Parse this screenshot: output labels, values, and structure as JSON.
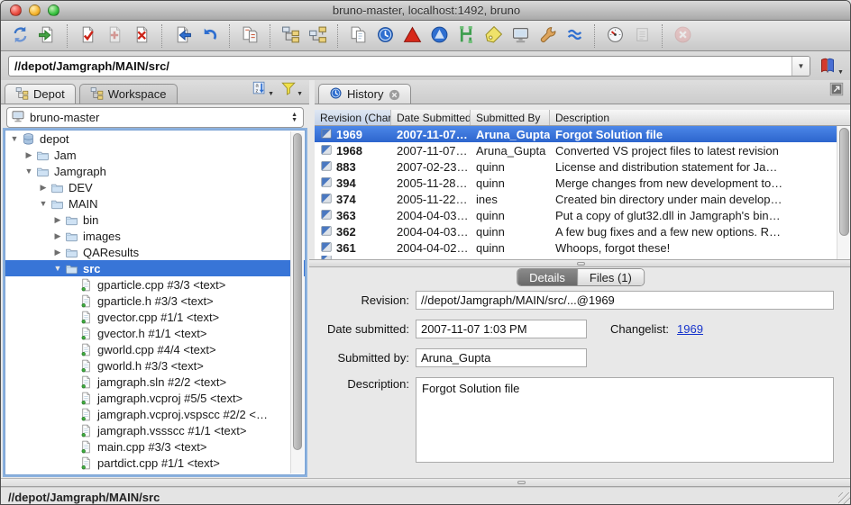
{
  "window": {
    "title": "bruno-master,  localhost:1492,  bruno"
  },
  "toolbar": {
    "groups": [
      [
        "refresh",
        "get-latest"
      ],
      [
        "checkout",
        "mark-for-add",
        "mark-for-delete"
      ],
      [
        "submit",
        "revert"
      ],
      [
        "diff"
      ],
      [
        "integrate",
        "branch"
      ],
      [
        "copy",
        "timelapse-view",
        "revision-graph",
        "merge-tool",
        "branch-view",
        "label",
        "workspaces",
        "administration",
        "streams"
      ],
      [
        "dashboard",
        "log"
      ],
      [
        "stop"
      ]
    ],
    "disabled": [
      "mark-for-add",
      "log",
      "stop"
    ]
  },
  "address": {
    "value": "//depot/Jamgraph/MAIN/src/"
  },
  "left": {
    "tabs": [
      {
        "label": "Depot",
        "active": true
      },
      {
        "label": "Workspace",
        "active": false
      }
    ],
    "workspace_selector": "bruno-master",
    "tree": [
      {
        "label": "depot",
        "icon": "depot",
        "depth": 0,
        "disclosure": "expanded"
      },
      {
        "label": "Jam",
        "icon": "folder",
        "depth": 1,
        "disclosure": "collapsed"
      },
      {
        "label": "Jamgraph",
        "icon": "folder",
        "depth": 1,
        "disclosure": "expanded"
      },
      {
        "label": "DEV",
        "icon": "folder",
        "depth": 2,
        "disclosure": "collapsed"
      },
      {
        "label": "MAIN",
        "icon": "folder",
        "depth": 2,
        "disclosure": "expanded"
      },
      {
        "label": "bin",
        "icon": "folder",
        "depth": 3,
        "disclosure": "collapsed"
      },
      {
        "label": "images",
        "icon": "folder",
        "depth": 3,
        "disclosure": "collapsed"
      },
      {
        "label": "QAResults",
        "icon": "folder",
        "depth": 3,
        "disclosure": "collapsed"
      },
      {
        "label": "src",
        "icon": "folder",
        "depth": 3,
        "disclosure": "expanded",
        "selected": true
      },
      {
        "label": "gparticle.cpp #3/3 <text>",
        "icon": "file",
        "depth": 4,
        "disclosure": "none"
      },
      {
        "label": "gparticle.h #3/3 <text>",
        "icon": "file",
        "depth": 4,
        "disclosure": "none"
      },
      {
        "label": "gvector.cpp #1/1 <text>",
        "icon": "file",
        "depth": 4,
        "disclosure": "none"
      },
      {
        "label": "gvector.h #1/1 <text>",
        "icon": "file",
        "depth": 4,
        "disclosure": "none"
      },
      {
        "label": "gworld.cpp #4/4 <text>",
        "icon": "file",
        "depth": 4,
        "disclosure": "none"
      },
      {
        "label": "gworld.h #3/3 <text>",
        "icon": "file",
        "depth": 4,
        "disclosure": "none"
      },
      {
        "label": "jamgraph.sln #2/2 <text>",
        "icon": "file",
        "depth": 4,
        "disclosure": "none"
      },
      {
        "label": "jamgraph.vcproj #5/5 <text>",
        "icon": "file",
        "depth": 4,
        "disclosure": "none"
      },
      {
        "label": "jamgraph.vcproj.vspscc #2/2 <…",
        "icon": "file",
        "depth": 4,
        "disclosure": "none"
      },
      {
        "label": "jamgraph.vssscc #1/1 <text>",
        "icon": "file",
        "depth": 4,
        "disclosure": "none"
      },
      {
        "label": "main.cpp #3/3 <text>",
        "icon": "file",
        "depth": 4,
        "disclosure": "none"
      },
      {
        "label": "partdict.cpp #1/1 <text>",
        "icon": "file",
        "depth": 4,
        "disclosure": "none"
      }
    ]
  },
  "history": {
    "tab_label": "History",
    "columns": {
      "revision": "Revision (Char",
      "date": "Date Submitted",
      "by": "Submitted By",
      "desc": "Description"
    },
    "sort_arrow": "▼",
    "rows": [
      {
        "revision": "1969",
        "date": "2007-11-07…",
        "by": "Aruna_Gupta",
        "desc": "Forgot Solution file",
        "selected": true
      },
      {
        "revision": "1968",
        "date": "2007-11-07…",
        "by": "Aruna_Gupta",
        "desc": "Converted VS project files to latest revision"
      },
      {
        "revision": "883",
        "date": "2007-02-23…",
        "by": "quinn",
        "desc": "License and distribution statement for Ja…"
      },
      {
        "revision": "394",
        "date": "2005-11-28…",
        "by": "quinn",
        "desc": "Merge changes from new development to…"
      },
      {
        "revision": "374",
        "date": "2005-11-22…",
        "by": "ines",
        "desc": "Created bin directory under main develop…"
      },
      {
        "revision": "363",
        "date": "2004-04-03…",
        "by": "quinn",
        "desc": "Put a copy of glut32.dll in Jamgraph's bin…"
      },
      {
        "revision": "362",
        "date": "2004-04-03…",
        "by": "quinn",
        "desc": "A few bug fixes and a few new options. R…"
      },
      {
        "revision": "361",
        "date": "2004-04-02…",
        "by": "quinn",
        "desc": "Whoops, forgot these!"
      }
    ]
  },
  "details": {
    "tabs": [
      {
        "label": "Details",
        "active": true
      },
      {
        "label": "Files (1)",
        "active": false
      }
    ],
    "revision_label": "Revision:",
    "revision_value": "//depot/Jamgraph/MAIN/src/...@1969",
    "date_label": "Date submitted:",
    "date_value": "2007-11-07 1:03 PM",
    "changelist_label": "Changelist:",
    "changelist_value": "1969",
    "submitted_label": "Submitted by:",
    "submitted_value": "Aruna_Gupta",
    "description_label": "Description:",
    "description_value": "Forgot Solution file"
  },
  "statusbar": {
    "path": "//depot/Jamgraph/MAIN/src"
  }
}
